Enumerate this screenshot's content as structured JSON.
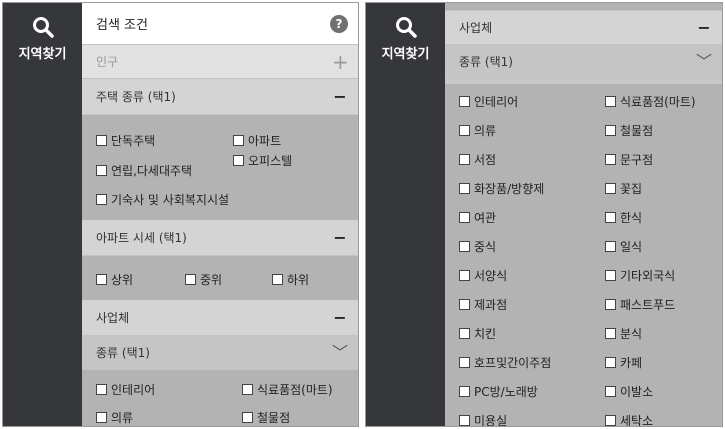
{
  "rail": {
    "title": "지역찾기",
    "icon": "search-icon"
  },
  "left": {
    "header": {
      "title": "검색 조건",
      "help": "?"
    },
    "population": {
      "title": "인구",
      "toggle": "+"
    },
    "housing": {
      "title": "주택 종류 (택1)",
      "toggle": "−",
      "options": [
        "단독주택",
        "아파트",
        "연립,다세대주택",
        "오피스텔",
        "기숙사 및 사회복지시설"
      ]
    },
    "apt_price": {
      "title": "아파트 시세 (택1)",
      "toggle": "−",
      "options": [
        "상위",
        "중위",
        "하위"
      ]
    },
    "business": {
      "title": "사업체",
      "toggle": "−",
      "type_title": "종류 (택1)",
      "type_toggle": "﹀",
      "options": [
        "인테리어",
        "식료품점(마트)",
        "의류",
        "철물점"
      ]
    }
  },
  "right": {
    "business": {
      "title": "사업체",
      "toggle": "−",
      "type_title": "종류 (택1)",
      "type_toggle": "﹀",
      "options": [
        "인테리어",
        "식료품점(마트)",
        "의류",
        "철물점",
        "서점",
        "문구점",
        "화장품/방향제",
        "꽃집",
        "여관",
        "한식",
        "중식",
        "일식",
        "서양식",
        "기타외국식",
        "제과점",
        "패스트푸드",
        "치킨",
        "분식",
        "호프및간이주점",
        "카페",
        "PC방/노래방",
        "이발소",
        "미용실",
        "세탁소"
      ]
    }
  }
}
